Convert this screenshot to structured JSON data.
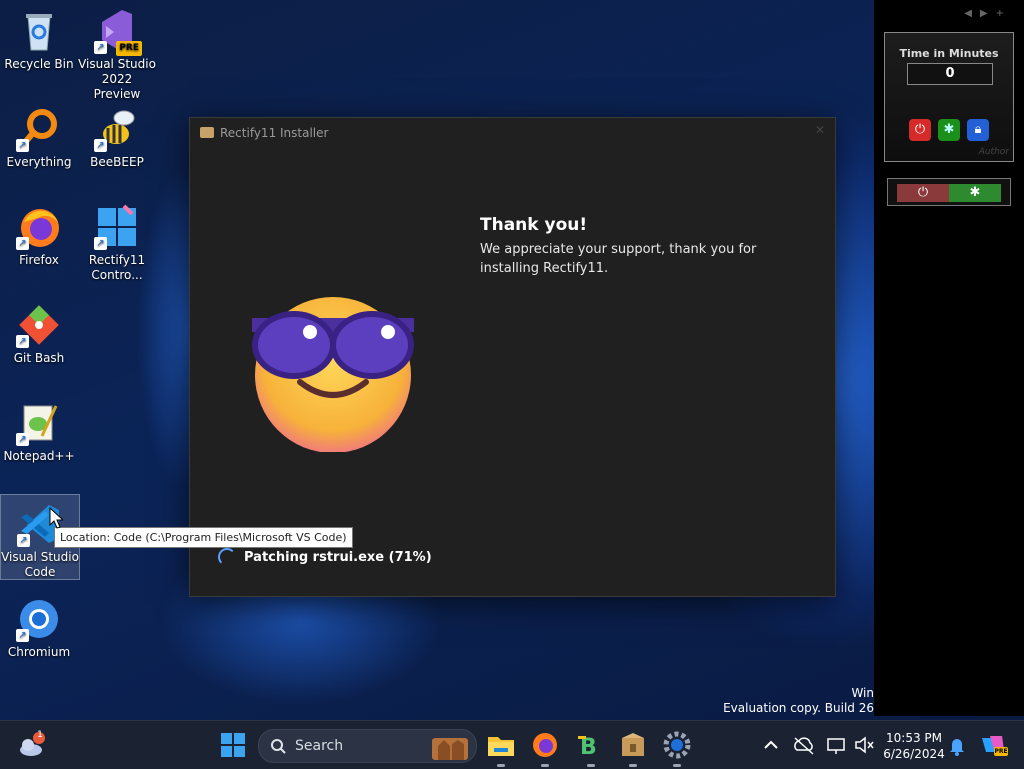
{
  "desktop": {
    "icons": [
      {
        "label": "Recycle Bin"
      },
      {
        "label": "Visual Studio 2022 Preview",
        "badge": "PRE"
      },
      {
        "label": "Everything"
      },
      {
        "label": "BeeBEEP"
      },
      {
        "label": "Firefox"
      },
      {
        "label": "Rectify11 Contro..."
      },
      {
        "label": "Git Bash"
      },
      {
        "label": "Notepad++"
      },
      {
        "label": "Visual Studio Code"
      },
      {
        "label": "Chromium"
      }
    ],
    "tooltip": "Location: Code (C:\\Program Files\\Microsoft VS Code)",
    "watermark_line1": "Win",
    "watermark_line2": "Evaluation copy. Build 26"
  },
  "installer": {
    "title": "Rectify11 Installer",
    "heading": "Thank you!",
    "message": "We appreciate your support, thank you for installing Rectify11.",
    "status": "Patching rstrui.exe (71%)",
    "progress_percent": 71
  },
  "gadgets": {
    "timer_title": "Time in Minutes",
    "timer_value": "0",
    "watermark": "Author"
  },
  "taskbar": {
    "search_placeholder": "Search",
    "time": "10:53 PM",
    "date": "6/26/2024",
    "weather_badge": "1",
    "copilot_badge": "PRE"
  },
  "colors": {
    "accent": "#1e6fd9",
    "window_bg": "#202020",
    "taskbar_bg": "#1b2333"
  }
}
